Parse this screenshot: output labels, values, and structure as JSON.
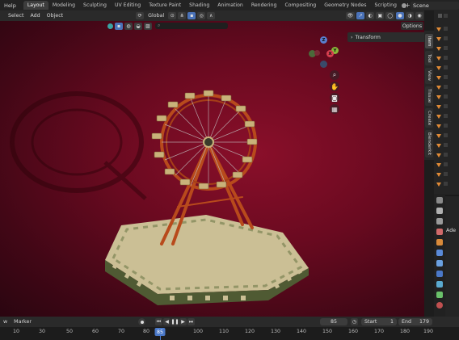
{
  "topbar": {
    "menu": [
      "Help"
    ],
    "tabs": [
      "Layout",
      "Modeling",
      "Sculpting",
      "UV Editing",
      "Texture Paint",
      "Shading",
      "Animation",
      "Rendering",
      "Compositing",
      "Geometry Nodes",
      "Scripting"
    ],
    "active_tab": "Layout",
    "add_tab": "+",
    "scene_name": "Scene"
  },
  "header": {
    "menus": [
      "Select",
      "Add",
      "Object"
    ],
    "orientation": "Global",
    "search_placeholder": "",
    "options_label": "Options"
  },
  "npanel": {
    "section": "Transform",
    "tabs": [
      "Item",
      "Tool",
      "View",
      "Tissue",
      "Create",
      "Blenderkit"
    ],
    "active_tab": "Item"
  },
  "gizmo": {
    "z": "Z",
    "y": "Y",
    "x": "X"
  },
  "outliner_partial": {
    "label": "Ade"
  },
  "timeline": {
    "menus": [
      "w",
      "Marker"
    ],
    "current_frame": "85",
    "start_label": "Start",
    "start_value": "1",
    "end_label": "End",
    "end_value": "179",
    "ruler_ticks": [
      "10",
      "30",
      "50",
      "70",
      "80",
      "85",
      "100",
      "110",
      "120",
      "130",
      "140",
      "150",
      "160",
      "170",
      "180",
      "190"
    ]
  },
  "colors": {
    "accent": "#4a78c8",
    "background_center": "#8a0f2a",
    "background_edge": "#2a0510",
    "wheel": "#b84a1c",
    "gondola": "#c9b27a",
    "platform": "#cbbf95",
    "platform_stripe": "#4f5a33"
  }
}
